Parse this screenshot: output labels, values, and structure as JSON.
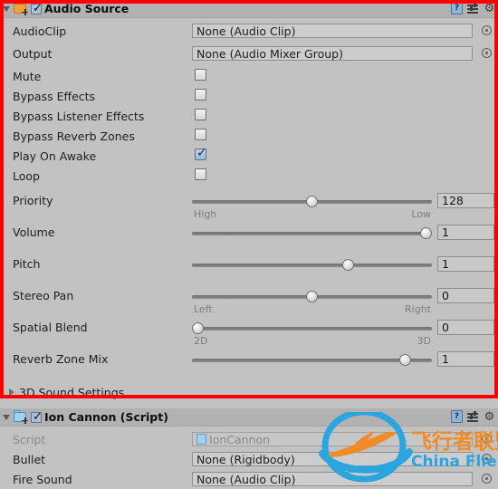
{
  "components": [
    {
      "title": "Audio Source",
      "icon": "audio-source-icon",
      "enabled": true,
      "expanded": true,
      "tools": {
        "help": "?",
        "help_name": "help-icon",
        "preset_name": "preset-icon",
        "gear_name": "gear-icon"
      },
      "object_fields": [
        {
          "label": "AudioClip",
          "value": "None (Audio Clip)",
          "dim": false
        },
        {
          "label": "Output",
          "value": "None (Audio Mixer Group)",
          "dim": false
        }
      ],
      "checkboxes": [
        {
          "label": "Mute",
          "checked": false
        },
        {
          "label": "Bypass Effects",
          "checked": false
        },
        {
          "label": "Bypass Listener Effects",
          "checked": false
        },
        {
          "label": "Bypass Reverb Zones",
          "checked": false
        },
        {
          "label": "Play On Awake",
          "checked": true
        },
        {
          "label": "Loop",
          "checked": false
        }
      ],
      "sliders": [
        {
          "label": "Priority",
          "value": "128",
          "pct": 50,
          "left_label": "High",
          "right_label": "Low"
        },
        {
          "label": "Volume",
          "value": "1",
          "pct": 100,
          "left_label": "",
          "right_label": ""
        },
        {
          "label": "Pitch",
          "value": "1",
          "pct": 66,
          "left_label": "",
          "right_label": ""
        },
        {
          "label": "Stereo Pan",
          "value": "0",
          "pct": 50,
          "left_label": "Left",
          "right_label": "Right"
        },
        {
          "label": "Spatial Blend",
          "value": "0",
          "pct": 0,
          "left_label": "2D",
          "right_label": "3D"
        },
        {
          "label": "Reverb Zone Mix",
          "value": "1",
          "pct": 91,
          "left_label": "",
          "right_label": ""
        }
      ],
      "foldouts": [
        {
          "label": "3D Sound Settings",
          "expanded": false
        }
      ]
    },
    {
      "title": "Ion Cannon (Script)",
      "icon": "script-icon",
      "enabled": true,
      "expanded": true,
      "tools": {
        "help": "?",
        "help_name": "help-icon",
        "preset_name": "preset-icon",
        "gear_name": "gear-icon"
      },
      "object_fields": [
        {
          "label": "Script",
          "value": "IonCannon",
          "dim": true
        },
        {
          "label": "Bullet",
          "value": "None (Rigidbody)",
          "dim": false
        },
        {
          "label": "Fire Sound",
          "value": "None (Audio Clip)",
          "dim": false
        }
      ],
      "checkboxes": [],
      "sliders": [],
      "foldouts": []
    }
  ],
  "watermark": {
    "text_cn": "飞行者联盟",
    "text_en": "China Flier",
    "orange": "#ef8c28",
    "blue": "#2ba5dd"
  },
  "highlight": {
    "color": "#ff0000"
  },
  "colors": {
    "panel_bg": "#c2c2c2",
    "header_bg": "#b2b2b2",
    "field_bg": "#cdcdcd"
  }
}
